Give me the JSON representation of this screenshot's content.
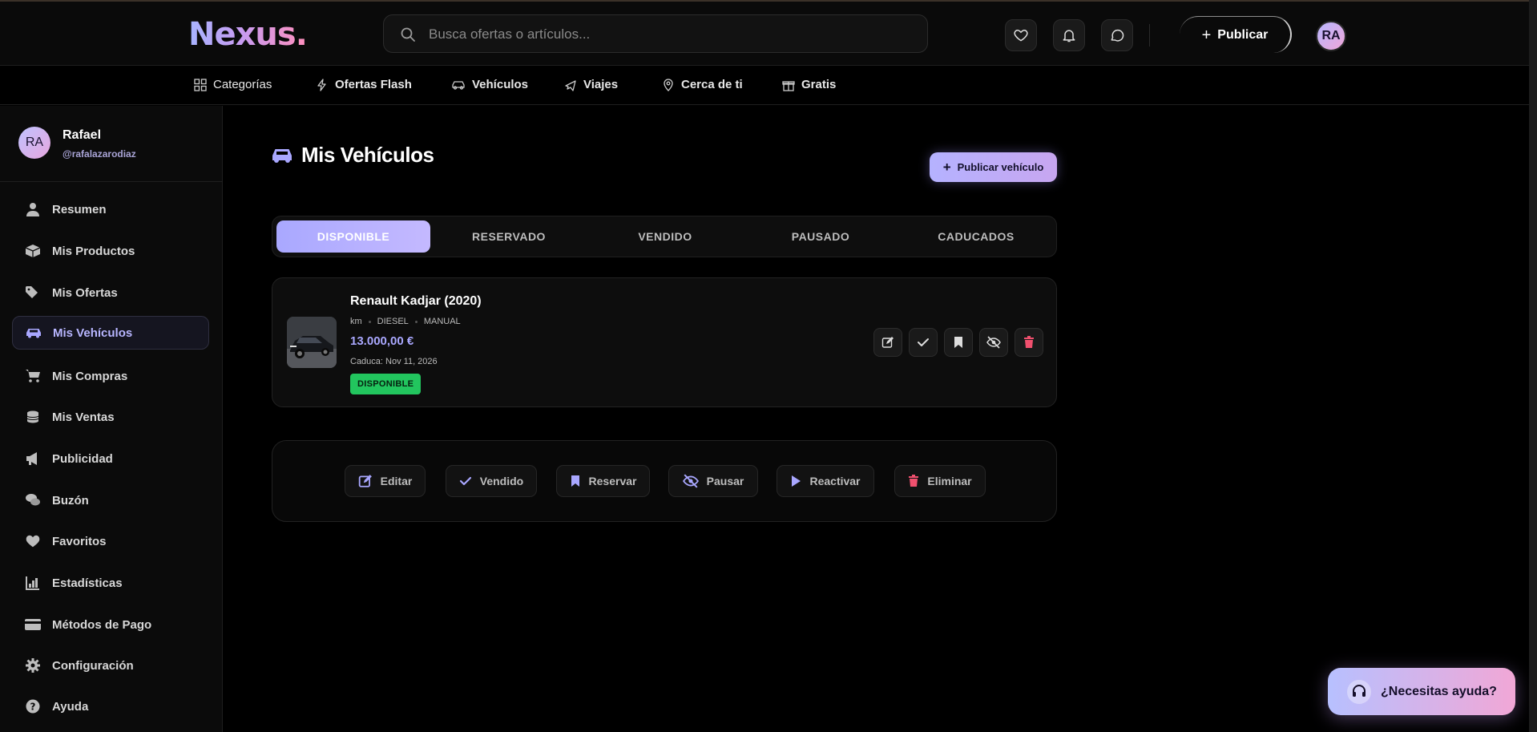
{
  "header": {
    "logo": "Nexus.",
    "search_placeholder": "Busca ofertas o artículos...",
    "publish_label": "Publicar",
    "avatar_initials": "RA"
  },
  "categories": [
    {
      "label": "Categorías",
      "icon": "grid-icon"
    },
    {
      "label": "Ofertas Flash",
      "icon": "lightning-icon"
    },
    {
      "label": "Vehículos",
      "icon": "car-icon"
    },
    {
      "label": "Viajes",
      "icon": "plane-icon"
    },
    {
      "label": "Cerca de ti",
      "icon": "map-pin-icon"
    },
    {
      "label": "Gratis",
      "icon": "gift-icon"
    }
  ],
  "user": {
    "initials": "RA",
    "name": "Rafael",
    "handle": "@rafalazarodiaz"
  },
  "sidebar": {
    "items": [
      {
        "label": "Resumen",
        "icon": "user-icon"
      },
      {
        "label": "Mis Productos",
        "icon": "box-icon"
      },
      {
        "label": "Mis Ofertas",
        "icon": "tags-icon"
      },
      {
        "label": "Mis Vehículos",
        "icon": "car-icon",
        "active": true
      },
      {
        "label": "Mis Compras",
        "icon": "cart-icon"
      },
      {
        "label": "Mis Ventas",
        "icon": "coins-icon"
      },
      {
        "label": "Publicidad",
        "icon": "megaphone-icon"
      },
      {
        "label": "Buzón",
        "icon": "chat-icon"
      },
      {
        "label": "Favoritos",
        "icon": "heart-icon"
      },
      {
        "label": "Estadísticas",
        "icon": "chart-icon"
      },
      {
        "label": "Métodos de Pago",
        "icon": "credit-card-icon"
      },
      {
        "label": "Configuración",
        "icon": "gear-icon"
      },
      {
        "label": "Ayuda",
        "icon": "question-icon"
      }
    ]
  },
  "main": {
    "title": "Mis Vehículos",
    "publish_vehicle_label": "Publicar vehículo",
    "tabs": [
      {
        "label": "DISPONIBLE",
        "active": true
      },
      {
        "label": "RESERVADO"
      },
      {
        "label": "VENDIDO"
      },
      {
        "label": "PAUSADO"
      },
      {
        "label": "CADUCADOS"
      }
    ],
    "vehicle": {
      "title": "Renault Kadjar (2020)",
      "meta": [
        "km",
        "DIESEL",
        "MANUAL"
      ],
      "price": "13.000,00 €",
      "expires": "Caduca: Nov 11, 2026",
      "status": "DISPONIBLE"
    },
    "card_actions": [
      "edit-icon",
      "check-icon",
      "bookmark-icon",
      "eye-off-icon",
      "trash-icon"
    ],
    "bulk_actions": [
      {
        "label": "Editar",
        "icon": "edit-icon"
      },
      {
        "label": "Vendido",
        "icon": "check-icon"
      },
      {
        "label": "Reservar",
        "icon": "bookmark-icon"
      },
      {
        "label": "Pausar",
        "icon": "eye-off-icon"
      },
      {
        "label": "Reactivar",
        "icon": "play-icon"
      },
      {
        "label": "Eliminar",
        "icon": "trash-icon"
      }
    ]
  },
  "help": {
    "label": "¿Necesitas ayuda?",
    "icon": "headset-icon"
  },
  "colors": {
    "accent": "#aaa8ff",
    "status_green": "#22c55e",
    "danger": "#f0506e"
  }
}
